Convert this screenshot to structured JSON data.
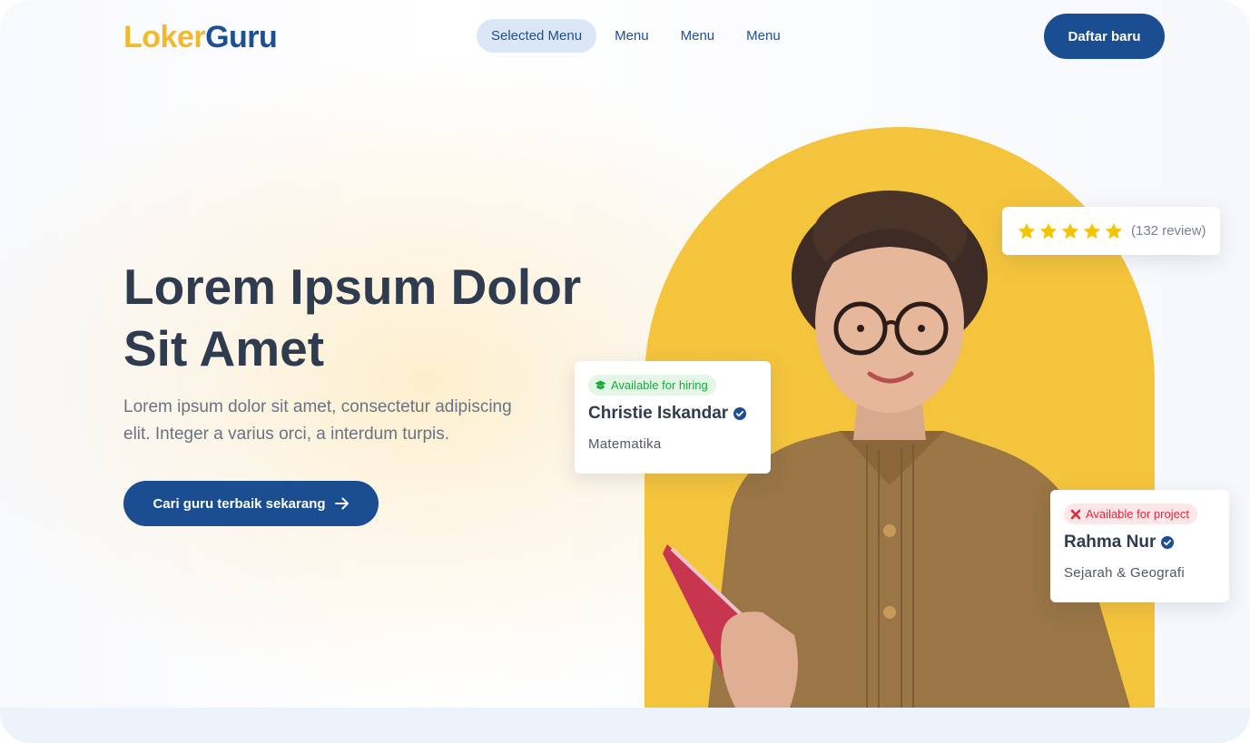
{
  "brand": {
    "part1": "Loker",
    "part2": "Guru"
  },
  "nav": {
    "selected": "Selected Menu",
    "items": [
      "Menu",
      "Menu",
      "Menu"
    ]
  },
  "header": {
    "cta_label": "Daftar baru"
  },
  "hero": {
    "title_line1": "Lorem Ipsum Dolor",
    "title_line2": "Sit Amet",
    "subtitle_line1": "Lorem ipsum dolor sit amet, consectetur adipiscing",
    "subtitle_line2": "elit. Integer a varius orci, a interdum turpis.",
    "cta_label": "Cari guru terbaik sekarang"
  },
  "rating": {
    "stars": 5,
    "review_text": "(132 review)"
  },
  "cards": [
    {
      "status": "Available for hiring",
      "status_icon": "hat-icon",
      "status_color": "#18a83a",
      "name": "Christie Iskandar",
      "subject": "Matematika"
    },
    {
      "status": "Available for project",
      "status_icon": "cross-icon",
      "status_color": "#e0283c",
      "name": "Rahma Nur",
      "subject": "Sejarah & Geografi"
    }
  ],
  "colors": {
    "brand_yellow": "#f2b92f",
    "brand_blue": "#1b4d91",
    "arch_yellow": "#f5c43d",
    "verified_blue": "#1c4f94"
  }
}
